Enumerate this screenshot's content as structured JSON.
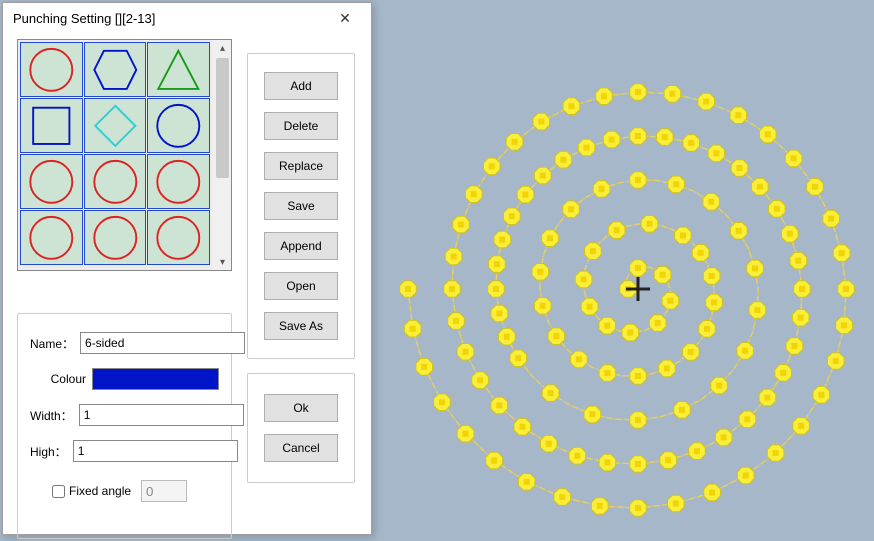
{
  "dialog": {
    "title": "Punching Setting [][2-13]",
    "close_glyph": "✕"
  },
  "buttons": {
    "add": "Add",
    "delete": "Delete",
    "replace": "Replace",
    "save": "Save",
    "append": "Append",
    "open": "Open",
    "save_as": "Save As",
    "ok": "Ok",
    "cancel": "Cancel"
  },
  "props": {
    "name_label": "Name：",
    "name_value": "6-sided",
    "colour_label": "Colour",
    "colour_value": "#0014c8",
    "width_label": "Width：",
    "width_value": "1",
    "high_label": "High：",
    "high_value": "1",
    "fixed_angle_label": "Fixed angle",
    "fixed_angle_checked": false,
    "fixed_angle_value": "0"
  },
  "shapes": [
    {
      "kind": "circle",
      "stroke": "#d22"
    },
    {
      "kind": "hexagon",
      "stroke": "#0014c8"
    },
    {
      "kind": "triangle",
      "stroke": "#1a9a1a"
    },
    {
      "kind": "square",
      "stroke": "#0014c8"
    },
    {
      "kind": "diamond",
      "stroke": "#2ad0d8"
    },
    {
      "kind": "circle",
      "stroke": "#0014c8"
    },
    {
      "kind": "circle",
      "stroke": "#d22"
    },
    {
      "kind": "circle",
      "stroke": "#d22"
    },
    {
      "kind": "circle",
      "stroke": "#d22"
    },
    {
      "kind": "circle",
      "stroke": "#d22"
    },
    {
      "kind": "circle",
      "stroke": "#d22"
    },
    {
      "kind": "circle",
      "stroke": "#d22"
    }
  ]
}
